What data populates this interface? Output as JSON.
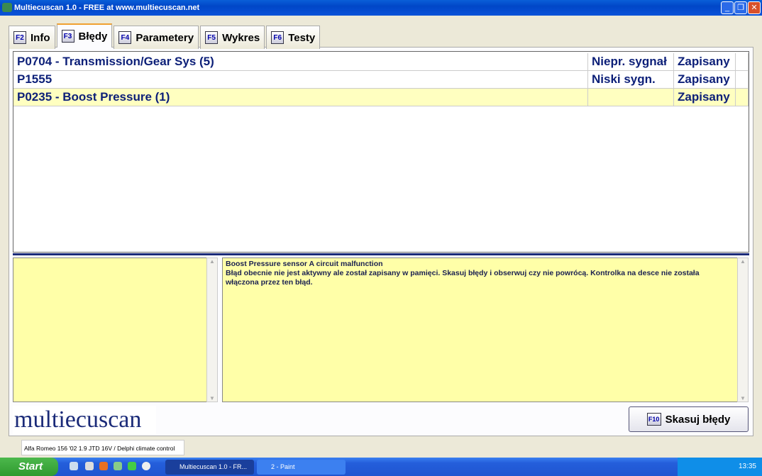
{
  "window": {
    "title": "Multiecuscan 1.0 - FREE at www.multiecuscan.net"
  },
  "tabs": [
    {
      "key": "F2",
      "label": "Info"
    },
    {
      "key": "F3",
      "label": "Błędy",
      "active": true
    },
    {
      "key": "F4",
      "label": "Parametery"
    },
    {
      "key": "F5",
      "label": "Wykres"
    },
    {
      "key": "F6",
      "label": "Testy"
    }
  ],
  "faults": [
    {
      "code": "P0704 - Transmission/Gear Sys (5)",
      "signal": "Niepr. sygnał",
      "state": "Zapisany"
    },
    {
      "code": "P1555",
      "signal": "Niski sygn.",
      "state": "Zapisany"
    },
    {
      "code": "P0235 - Boost Pressure (1)",
      "signal": "",
      "state": "Zapisany",
      "selected": true
    }
  ],
  "detail": {
    "title": "Boost Pressure sensor A circuit malfunction",
    "text": "Błąd obecnie nie jest aktywny ale został zapisany w pamięci. Skasuj błędy i obserwuj czy nie powrócą. Kontrolka na desce nie została włączona przez ten błąd."
  },
  "logo": "multiecuscan",
  "clear_button": {
    "key": "F10",
    "label": "Skasuj błędy"
  },
  "status": "Alfa Romeo 156 '02 1.9 JTD 16V / Delphi climate control",
  "taskbar": {
    "start": "Start",
    "tasks": [
      "Multiecuscan 1.0 - FR...",
      "2 - Paint"
    ],
    "clock": "13:35"
  },
  "colors": {
    "selected_row": "#ffffc0",
    "text": "#0c1f78",
    "panel_yellow": "#ffffa8"
  }
}
